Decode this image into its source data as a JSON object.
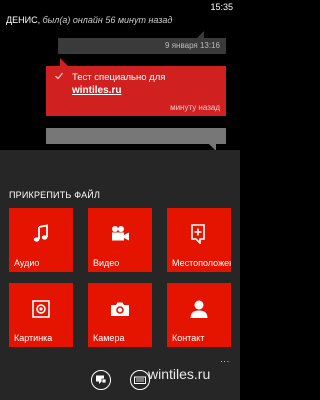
{
  "status_bar": {
    "time": "15:35"
  },
  "conversation": {
    "contact_name": "ДЕНИС,",
    "contact_status": " был(а) онлайн 56 минут назад",
    "timestamp": "9 января 13:16",
    "message": {
      "text": "Тест специально для",
      "link": "wintiles.ru",
      "time": "минуту назад"
    }
  },
  "attach_panel": {
    "title": "ПРИКРЕПИТЬ ФАЙЛ",
    "tiles": [
      {
        "label": "Аудио",
        "icon": "music-note-icon"
      },
      {
        "label": "Видео",
        "icon": "video-camera-icon"
      },
      {
        "label": "Местоположение",
        "icon": "location-icon"
      },
      {
        "label": "Картинка",
        "icon": "picture-icon"
      },
      {
        "label": "Камера",
        "icon": "camera-icon"
      },
      {
        "label": "Контакт",
        "icon": "person-icon"
      }
    ],
    "more": "..."
  },
  "watermark": "wintiles.ru",
  "colors": {
    "tile": "#e51400",
    "message": "#d02020"
  }
}
